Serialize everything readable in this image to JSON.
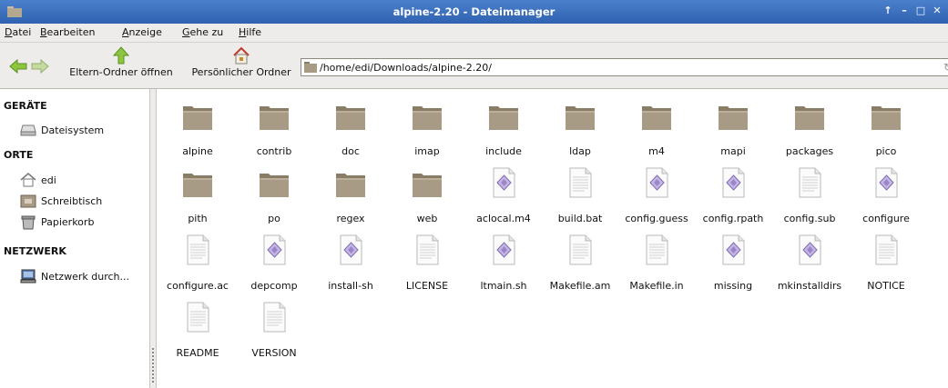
{
  "window": {
    "title": "alpine-2.20 - Dateimanager",
    "controls": [
      "↑",
      "–",
      "□",
      "✕"
    ]
  },
  "menu": [
    {
      "label": "Datei",
      "mnemonic": "D",
      "rest": "atei"
    },
    {
      "label": "Bearbeiten",
      "mnemonic": "B",
      "rest": "earbeiten"
    },
    {
      "label": "Anzeige",
      "mnemonic": "A",
      "rest": "nzeige"
    },
    {
      "label": "Gehe zu",
      "mnemonic": "G",
      "rest": "ehe zu"
    },
    {
      "label": "Hilfe",
      "mnemonic": "H",
      "rest": "ilfe"
    }
  ],
  "toolbar": {
    "back_icon": "back-arrow-icon",
    "forward_icon": "forward-arrow-icon",
    "parent_label": "Eltern-Ordner öffnen",
    "home_label": "Persönlicher Ordner"
  },
  "location": {
    "path": "/home/edi/Downloads/alpine-2.20/"
  },
  "sidebar": {
    "sections": [
      {
        "title": "GERÄTE",
        "items": [
          {
            "label": "Dateisystem",
            "icon": "drive-icon"
          }
        ]
      },
      {
        "title": "ORTE",
        "items": [
          {
            "label": "edi",
            "icon": "home-icon"
          },
          {
            "label": "Schreibtisch",
            "icon": "desktop-icon"
          },
          {
            "label": "Papierkorb",
            "icon": "trash-icon"
          }
        ]
      },
      {
        "title": "NETZWERK",
        "items": [
          {
            "label": "Netzwerk durch...",
            "icon": "network-icon"
          }
        ]
      }
    ]
  },
  "files": [
    {
      "name": "alpine",
      "type": "folder"
    },
    {
      "name": "contrib",
      "type": "folder"
    },
    {
      "name": "doc",
      "type": "folder"
    },
    {
      "name": "imap",
      "type": "folder"
    },
    {
      "name": "include",
      "type": "folder"
    },
    {
      "name": "ldap",
      "type": "folder"
    },
    {
      "name": "m4",
      "type": "folder"
    },
    {
      "name": "mapi",
      "type": "folder"
    },
    {
      "name": "packages",
      "type": "folder"
    },
    {
      "name": "pico",
      "type": "folder"
    },
    {
      "name": "pith",
      "type": "folder"
    },
    {
      "name": "po",
      "type": "folder"
    },
    {
      "name": "regex",
      "type": "folder"
    },
    {
      "name": "web",
      "type": "folder"
    },
    {
      "name": "aclocal.m4",
      "type": "script"
    },
    {
      "name": "build.bat",
      "type": "text"
    },
    {
      "name": "config.guess",
      "type": "script"
    },
    {
      "name": "config.rpath",
      "type": "script"
    },
    {
      "name": "config.sub",
      "type": "text"
    },
    {
      "name": "configure",
      "type": "script"
    },
    {
      "name": "configure.ac",
      "type": "text"
    },
    {
      "name": "depcomp",
      "type": "script"
    },
    {
      "name": "install-sh",
      "type": "script"
    },
    {
      "name": "LICENSE",
      "type": "text"
    },
    {
      "name": "ltmain.sh",
      "type": "script"
    },
    {
      "name": "Makefile.am",
      "type": "text"
    },
    {
      "name": "Makefile.in",
      "type": "text"
    },
    {
      "name": "missing",
      "type": "script"
    },
    {
      "name": "mkinstalldirs",
      "type": "script"
    },
    {
      "name": "NOTICE",
      "type": "text"
    },
    {
      "name": "README",
      "type": "text"
    },
    {
      "name": "VERSION",
      "type": "text"
    }
  ],
  "colors": {
    "titlebar": "#3a6fbf",
    "folder": "#a89b86",
    "script_diamond": "#9a86c8",
    "chrome": "#edecea"
  }
}
